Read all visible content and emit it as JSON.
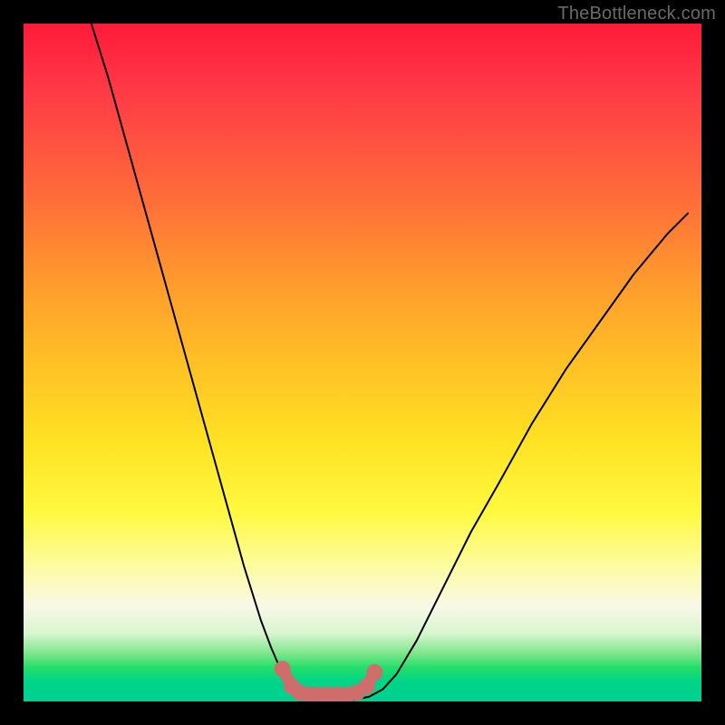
{
  "watermark": {
    "text": "TheBottleneck.com"
  },
  "chart_data": {
    "type": "line",
    "title": "",
    "xlabel": "",
    "ylabel": "",
    "xlim": [
      0,
      100
    ],
    "ylim": [
      0,
      100
    ],
    "series": [
      {
        "name": "curve",
        "x": [
          10.0,
          12.5,
          15.0,
          17.5,
          20.0,
          22.5,
          25.0,
          27.5,
          30.0,
          32.5,
          35.0,
          36.5,
          38.0,
          39.0,
          40.0,
          41.0,
          42.0,
          43.0,
          45.0,
          47.0,
          49.0,
          51.0,
          53.0,
          55.0,
          58.0,
          62.0,
          66.0,
          70.0,
          75.0,
          80.0,
          85.0,
          90.0,
          95.0,
          98.0
        ],
        "y": [
          100.0,
          92.0,
          83.0,
          74.0,
          65.0,
          56.0,
          47.0,
          38.0,
          29.0,
          20.0,
          12.0,
          8.0,
          4.5,
          2.5,
          1.2,
          0.6,
          0.3,
          0.2,
          0.2,
          0.2,
          0.3,
          0.7,
          1.8,
          4.0,
          9.0,
          17.0,
          25.0,
          32.0,
          41.0,
          49.0,
          56.0,
          63.0,
          69.0,
          72.0
        ]
      }
    ],
    "markers": {
      "name": "bottom-dots",
      "color": "#cf6d6d",
      "points": [
        {
          "x": 38.2,
          "y": 4.8
        },
        {
          "x": 39.6,
          "y": 2.2
        },
        {
          "x": 40.8,
          "y": 1.3
        },
        {
          "x": 42.2,
          "y": 1.0
        },
        {
          "x": 43.6,
          "y": 1.0
        },
        {
          "x": 45.0,
          "y": 1.0
        },
        {
          "x": 46.4,
          "y": 1.0
        },
        {
          "x": 47.8,
          "y": 1.0
        },
        {
          "x": 49.2,
          "y": 1.3
        },
        {
          "x": 50.6,
          "y": 2.2
        },
        {
          "x": 51.8,
          "y": 4.3
        }
      ]
    }
  }
}
